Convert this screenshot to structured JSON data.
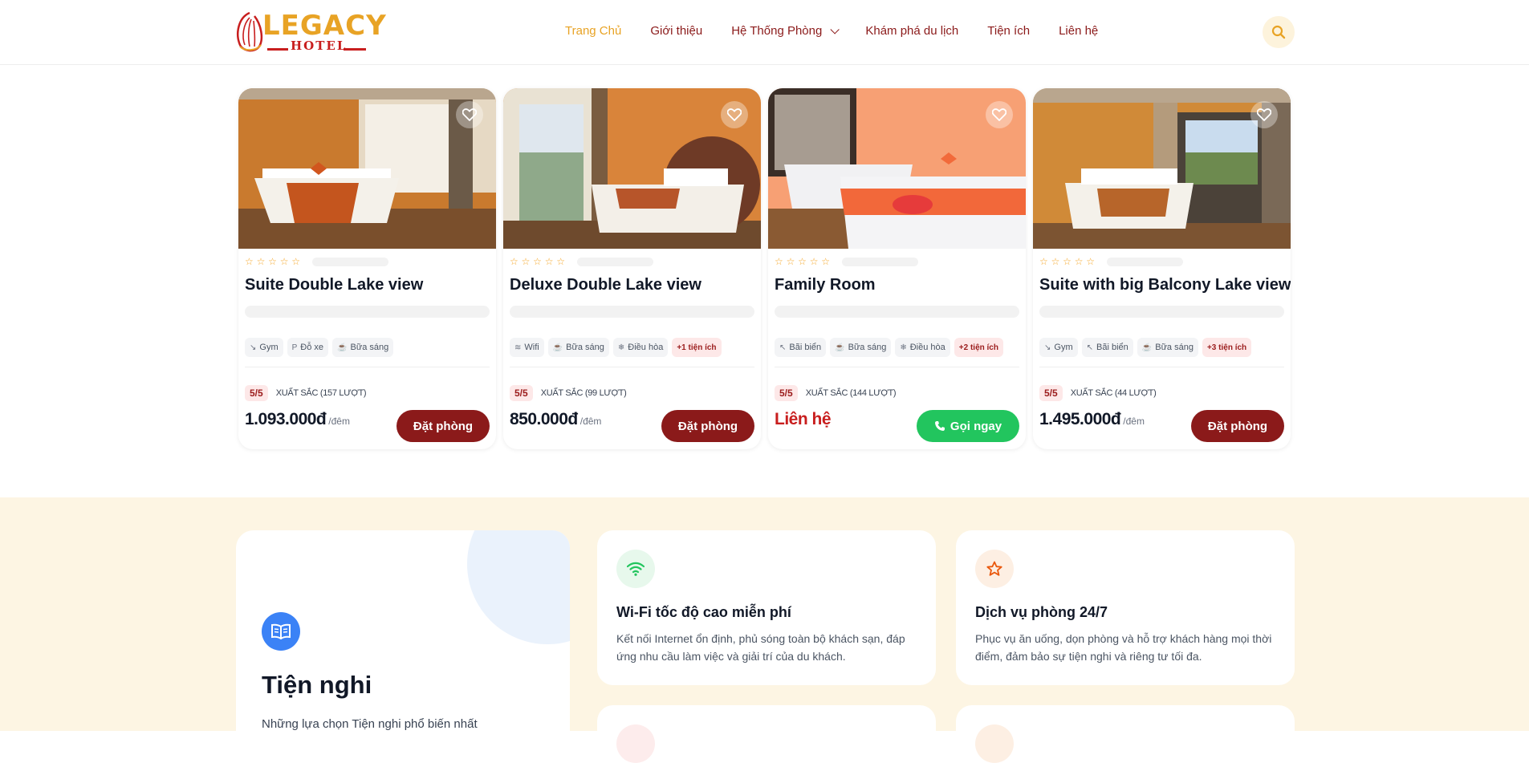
{
  "header": {
    "logo_word": "LEGACY",
    "logo_sub": "HOTEL",
    "nav": [
      {
        "label": "Trang Chủ"
      },
      {
        "label": "Giới thiệu"
      },
      {
        "label": "Hệ Thống Phòng"
      },
      {
        "label": "Khám phá du lịch"
      },
      {
        "label": "Tiện ích"
      },
      {
        "label": "Liên hệ"
      }
    ],
    "search_icon": "search-icon"
  },
  "rooms": [
    {
      "title": "Suite Double Lake view",
      "stars": "☆ ☆ ☆ ☆ ☆",
      "amenities": [
        {
          "icon": "↘",
          "label": "Gym"
        },
        {
          "icon": "P",
          "label": "Đỗ xe"
        },
        {
          "icon": "☕",
          "label": "Bữa sáng"
        }
      ],
      "score": "5/5",
      "rating_text": "XUẤT SẮC (157 LƯỢT)",
      "price": "1.093.000đ",
      "per": "/đêm",
      "button": "Đặt phòng"
    },
    {
      "title": "Deluxe Double Lake view",
      "stars": "☆ ☆ ☆ ☆ ☆",
      "amenities": [
        {
          "icon": "≋",
          "label": "Wifi"
        },
        {
          "icon": "☕",
          "label": "Bữa sáng"
        },
        {
          "icon": "❄",
          "label": "Điều hòa"
        }
      ],
      "more": "+1 tiện ích",
      "score": "5/5",
      "rating_text": "XUẤT SẮC (99 LƯỢT)",
      "price": "850.000đ",
      "per": "/đêm",
      "button": "Đặt phòng"
    },
    {
      "title": "Family Room",
      "stars": "☆ ☆ ☆ ☆ ☆",
      "amenities": [
        {
          "icon": "↖",
          "label": "Bãi biển"
        },
        {
          "icon": "☕",
          "label": "Bữa sáng"
        },
        {
          "icon": "❄",
          "label": "Điều hòa"
        }
      ],
      "more": "+2 tiện ích",
      "score": "5/5",
      "rating_text": "XUẤT SẮC (144 LƯỢT)",
      "price": "Liên hệ",
      "button": "Gọi ngay"
    },
    {
      "title": "Suite with big Balcony Lake view",
      "stars": "☆ ☆ ☆ ☆ ☆",
      "amenities": [
        {
          "icon": "↘",
          "label": "Gym"
        },
        {
          "icon": "↖",
          "label": "Bãi biển"
        },
        {
          "icon": "☕",
          "label": "Bữa sáng"
        }
      ],
      "more": "+3 tiện ích",
      "score": "5/5",
      "rating_text": "XUẤT SẮC (44 LƯỢT)",
      "price": "1.495.000đ",
      "per": "/đêm",
      "button": "Đặt phòng"
    }
  ],
  "amenities_section": {
    "title": "Tiện nghi",
    "desc": "Những lựa chọn Tiện nghi phổ biến nhất",
    "features": [
      {
        "title": "Wi-Fi tốc độ cao miễn phí",
        "desc": "Kết nối Internet ổn định, phủ sóng toàn bộ khách sạn, đáp ứng nhu cầu làm việc và giải trí của du khách."
      },
      {
        "title": "Dịch vụ phòng 24/7",
        "desc": "Phục vụ ăn uống, dọn phòng và hỗ trợ khách hàng mọi thời điểm, đảm bảo sự tiện nghi và riêng tư tối đa."
      }
    ]
  }
}
